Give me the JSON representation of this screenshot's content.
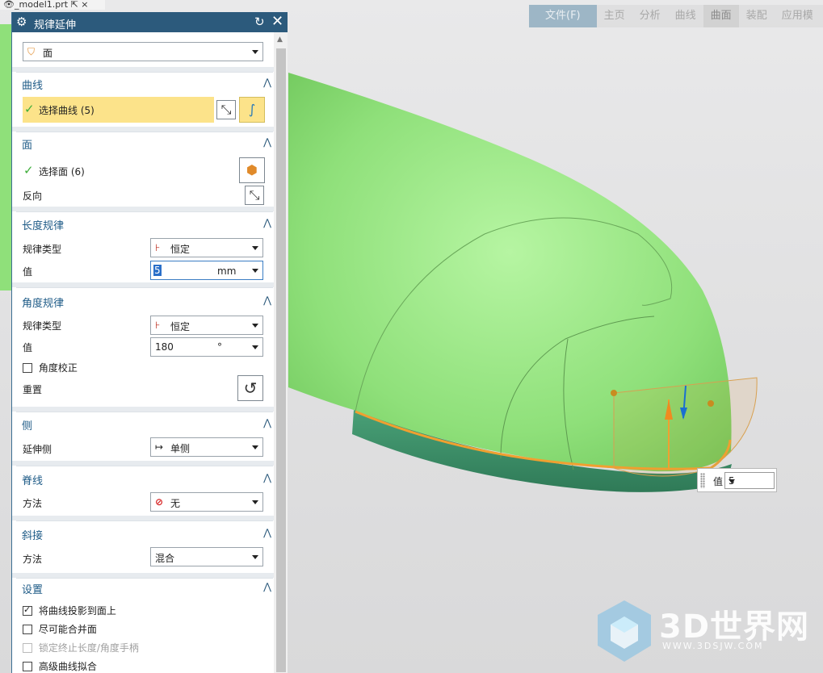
{
  "file_tab": {
    "name": "_model1.prt",
    "close": "×"
  },
  "ribbon": {
    "tabs": [
      "文件(F)",
      "主页",
      "分析",
      "曲线",
      "曲面",
      "装配",
      "应用模"
    ]
  },
  "dialog": {
    "title": "规律延伸",
    "type_dropdown": "面",
    "sections": {
      "curve": {
        "header": "曲线",
        "select_label": "选择曲线 (5)"
      },
      "face": {
        "header": "面",
        "select_label": "选择面 (6)",
        "reverse_label": "反向"
      },
      "length_law": {
        "header": "长度规律",
        "type_label": "规律类型",
        "type_value": "恒定",
        "value_label": "值",
        "value": "5",
        "unit": "mm"
      },
      "angle_law": {
        "header": "角度规律",
        "type_label": "规律类型",
        "type_value": "恒定",
        "value_label": "值",
        "value": "180",
        "unit": "°",
        "correction_label": "角度校正",
        "reset_label": "重置"
      },
      "side": {
        "header": "侧",
        "extend_label": "延伸侧",
        "extend_value": "单侧"
      },
      "spine": {
        "header": "脊线",
        "method_label": "方法",
        "method_value": "无"
      },
      "miter": {
        "header": "斜接",
        "method_label": "方法",
        "method_value": "混合"
      },
      "settings": {
        "header": "设置",
        "options": [
          {
            "label": "将曲线投影到面上",
            "checked": true,
            "disabled": false
          },
          {
            "label": "尽可能合并面",
            "checked": false,
            "disabled": false
          },
          {
            "label": "锁定终止长度/角度手柄",
            "checked": false,
            "disabled": true
          },
          {
            "label": "高级曲线拟合",
            "checked": false,
            "disabled": false
          }
        ]
      }
    }
  },
  "viewport": {
    "value_box": {
      "label": "值",
      "value": "5"
    },
    "watermark": {
      "title": "3D世界网",
      "url": "WWW.3DSJW.COM"
    }
  },
  "colors": {
    "title_bar": "#2c5a7c",
    "selected_row": "#fce38a",
    "model_green": "#8fe07a",
    "extension_face": "#3f8f6a",
    "handle_orange": "#f0a030"
  }
}
